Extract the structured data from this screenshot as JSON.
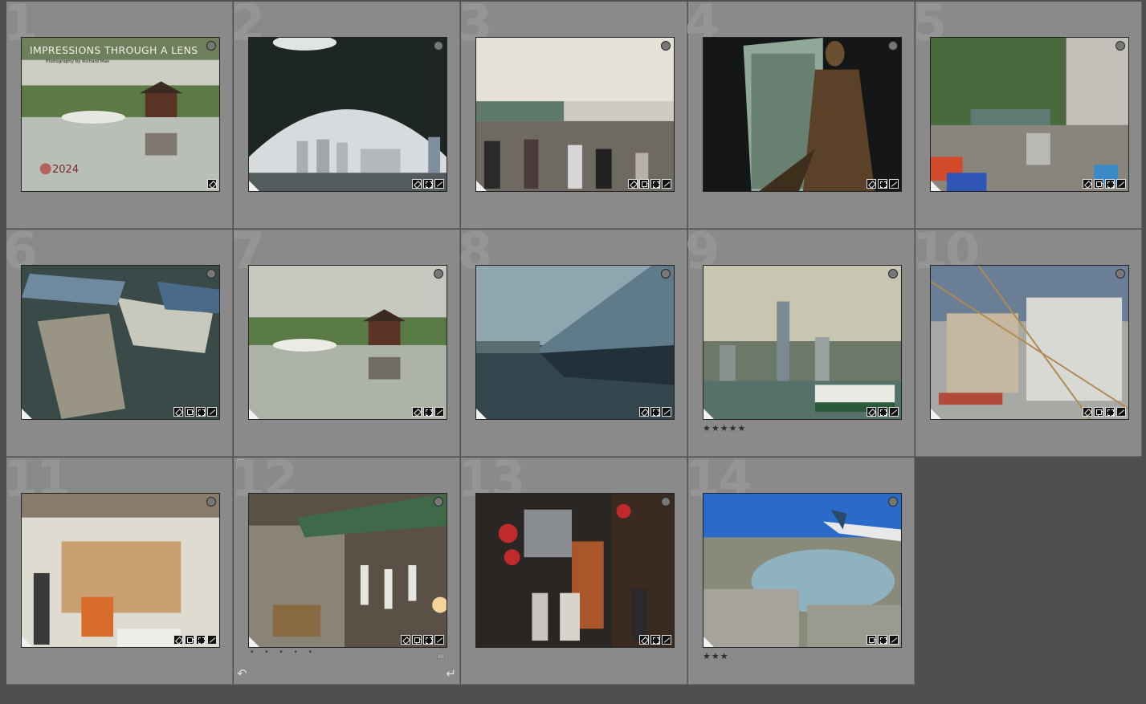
{
  "grid": {
    "cells": [
      {
        "num": "1",
        "stars": "",
        "badges": [
          "tag"
        ],
        "corner": false
      },
      {
        "num": "2",
        "stars": "",
        "badges": [
          "tag",
          "crop",
          "dev"
        ],
        "corner": true
      },
      {
        "num": "3",
        "stars": "",
        "badges": [
          "tag",
          "stack",
          "crop",
          "dev"
        ],
        "corner": true
      },
      {
        "num": "4",
        "stars": "",
        "badges": [
          "tag",
          "crop",
          "dev"
        ],
        "corner": false
      },
      {
        "num": "5",
        "stars": "",
        "badges": [
          "tag",
          "stack",
          "crop",
          "dev"
        ],
        "corner": true
      },
      {
        "num": "6",
        "stars": "",
        "badges": [
          "tag",
          "stack",
          "crop",
          "dev"
        ],
        "corner": true
      },
      {
        "num": "7",
        "stars": "",
        "badges": [
          "tag",
          "crop",
          "dev"
        ],
        "corner": true
      },
      {
        "num": "8",
        "stars": "",
        "badges": [
          "tag",
          "crop",
          "dev"
        ],
        "corner": true
      },
      {
        "num": "9",
        "stars": "★★★★★",
        "badges": [
          "tag",
          "crop",
          "dev"
        ],
        "corner": true
      },
      {
        "num": "10",
        "stars": "",
        "badges": [
          "tag",
          "stack",
          "crop",
          "dev"
        ],
        "corner": true
      },
      {
        "num": "11",
        "stars": "",
        "badges": [
          "tag",
          "stack",
          "crop",
          "dev"
        ],
        "corner": true
      },
      {
        "num": "12",
        "stars": "",
        "dots": "• • • • •",
        "badges": [
          "tag",
          "stack",
          "crop",
          "dev"
        ],
        "corner": true,
        "selected": true
      },
      {
        "num": "13",
        "stars": "",
        "badges": [
          "tag",
          "crop",
          "dev"
        ],
        "corner": false
      },
      {
        "num": "14",
        "stars": "★★★",
        "badges": [
          "stack",
          "crop",
          "dev"
        ],
        "corner": true
      }
    ]
  },
  "cover": {
    "title": "IMPRESSIONS THROUGH A LENS",
    "subtitle": "Photography by Richard Man",
    "year": "2024"
  },
  "colors": {
    "cell_bg": "#8a8a8a",
    "page_bg": "#4f4f4f",
    "empty_cell": "#4f4f4f"
  }
}
